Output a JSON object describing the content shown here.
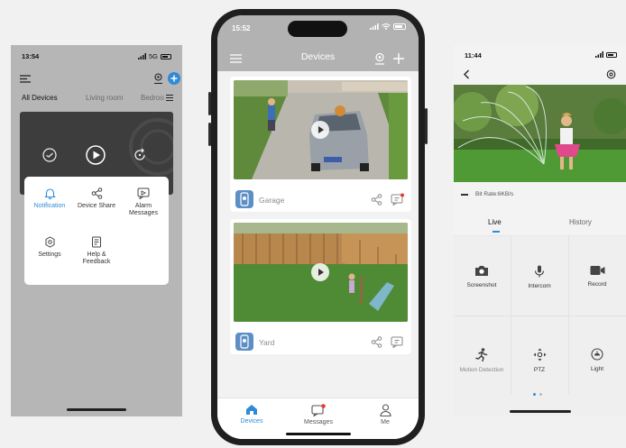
{
  "left_phone": {
    "status_time": "13:54",
    "status_network": "5G",
    "tabs": [
      "All Devices",
      "Living room",
      "Bedroo"
    ],
    "popup_items": [
      "Notification",
      "Device Share",
      "Alarm Messages",
      "Settings",
      "Help & Feedback"
    ],
    "accent": "#2f8bd8"
  },
  "center_phone": {
    "status_time": "15:52",
    "title": "Devices",
    "cards": [
      {
        "label": "Garage"
      },
      {
        "label": "Yard"
      }
    ],
    "nav": [
      "Devices",
      "Messages",
      "Me"
    ],
    "accent": "#2f8bd8",
    "badge_color": "#e53935"
  },
  "right_phone": {
    "status_time": "11:44",
    "bitrate": "Bit Rate:6KB/s",
    "tabs": [
      "Live",
      "History"
    ],
    "controls": [
      "Screenshot",
      "Intercom",
      "Record",
      "Motion Detection",
      "PTZ",
      "Light"
    ],
    "page_dots": 2,
    "active_page": 1
  }
}
